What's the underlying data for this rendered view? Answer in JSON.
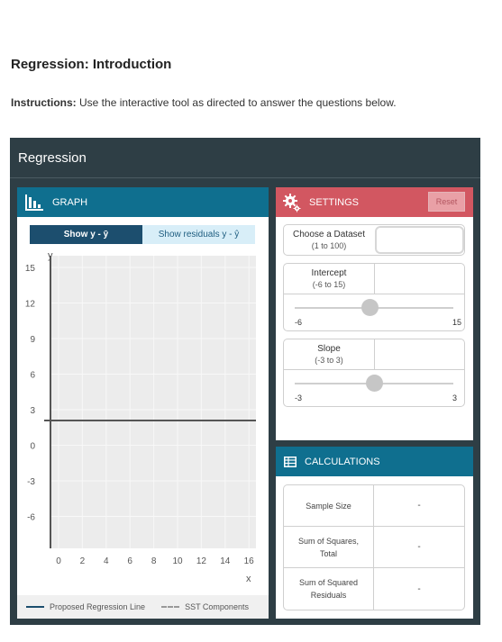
{
  "page": {
    "title": "Regression: Introduction",
    "instructions_label": "Instructions:",
    "instructions_text": " Use the interactive tool as directed to answer the questions below."
  },
  "app": {
    "title": "Regression",
    "graph": {
      "header": "GRAPH",
      "toggle_active": "Show y - ȳ",
      "toggle_inactive": "Show residuals y - ŷ",
      "y_axis_label": "y",
      "x_axis_label": "x",
      "y_ticks": [
        "15",
        "12",
        "9",
        "6",
        "3",
        "0",
        "-3",
        "-6"
      ],
      "x_ticks": [
        "0",
        "2",
        "4",
        "6",
        "8",
        "10",
        "12",
        "14",
        "16"
      ],
      "legend": {
        "line": "Proposed Regression Line",
        "sst": "SST Components"
      }
    },
    "settings": {
      "header": "SETTINGS",
      "reset": "Reset",
      "dataset_label": "Choose a Dataset",
      "dataset_range": "(1 to 100)",
      "intercept_label": "Intercept",
      "intercept_range": "(-6 to 15)",
      "intercept_min": "-6",
      "intercept_max": "15",
      "intercept_value": 4,
      "slope_label": "Slope",
      "slope_range": "(-3 to 3)",
      "slope_min": "-3",
      "slope_max": "3",
      "slope_value": 0
    },
    "calculations": {
      "header": "CALCULATIONS",
      "rows": [
        {
          "label": "Sample Size",
          "value": "-"
        },
        {
          "label": "Sum of Squares, Total",
          "value": "-"
        },
        {
          "label": "Sum of Squared Residuals",
          "value": "-"
        }
      ]
    }
  },
  "colors": {
    "app_bg": "#2e3e45",
    "graph_header": "#0f6f8f",
    "settings_header": "#d25761",
    "toggle_active": "#1c4e6e",
    "toggle_inactive": "#d8eef8"
  }
}
